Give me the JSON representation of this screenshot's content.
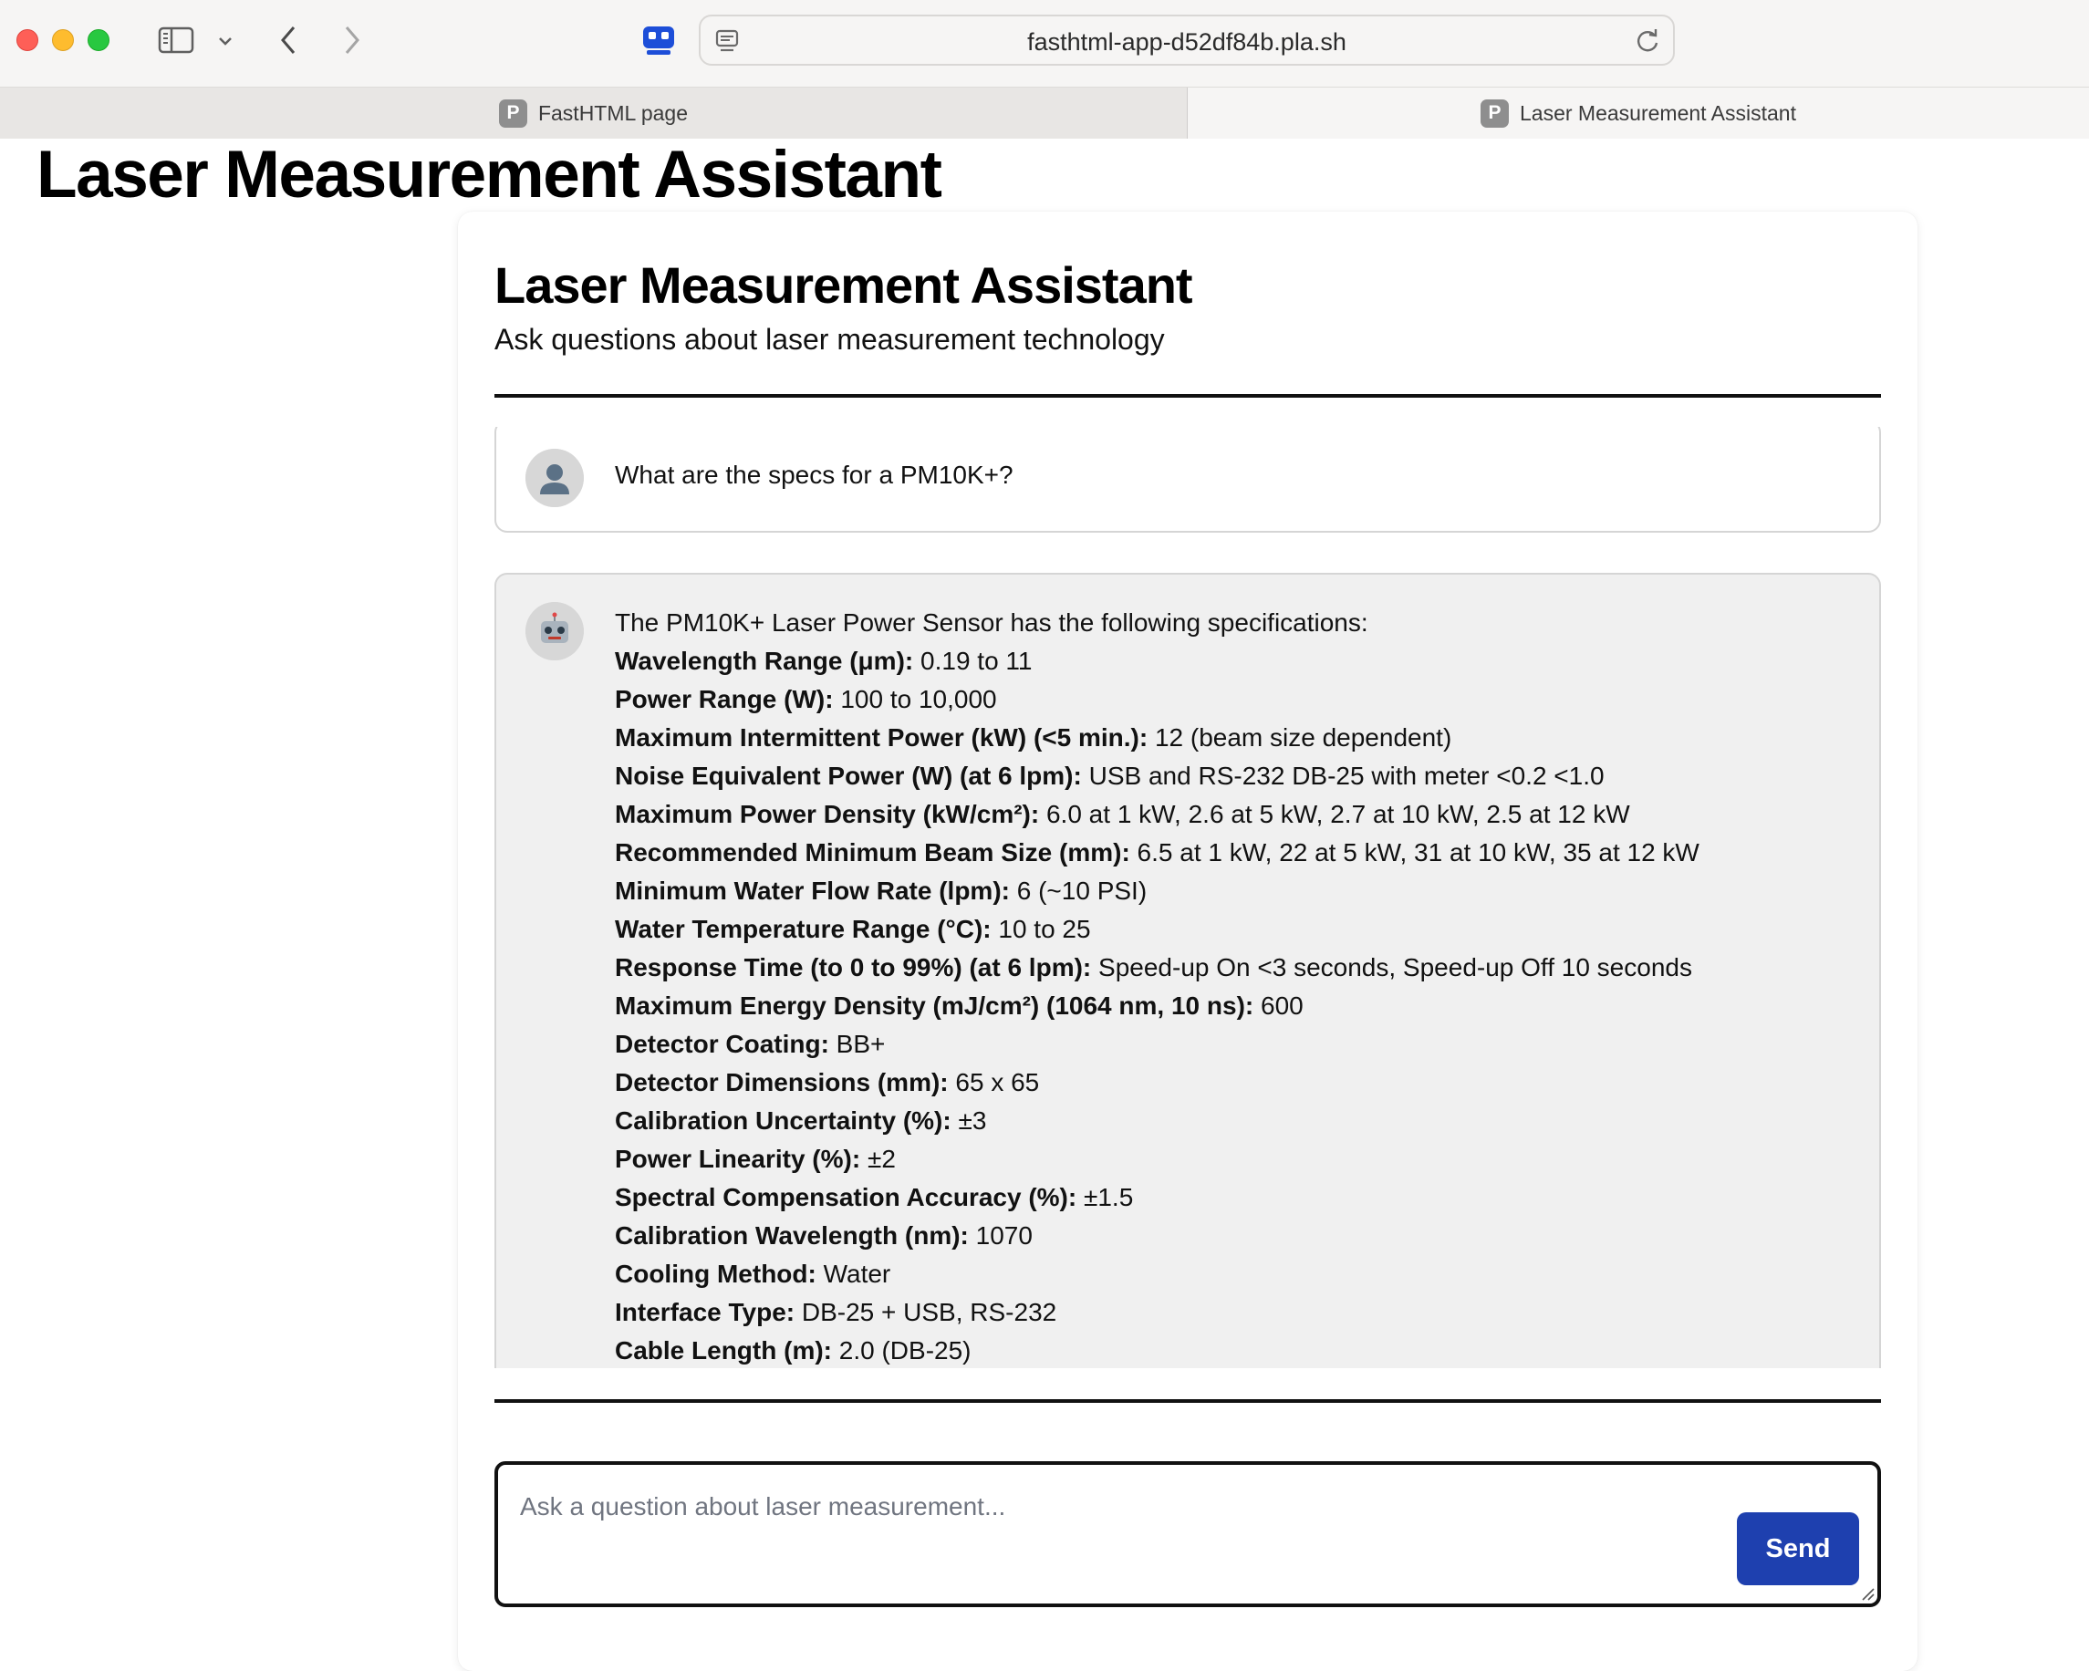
{
  "browser": {
    "url": "fasthtml-app-d52df84b.pla.sh",
    "tabs": [
      {
        "favicon_letter": "P",
        "label": "FastHTML page"
      },
      {
        "favicon_letter": "P",
        "label": "Laser Measurement Assistant"
      }
    ],
    "icons": {
      "sidebar_toggle": "sidebar-icon",
      "chevron": "chevron-down-icon",
      "back": "chevron-left-icon",
      "forward": "chevron-right-icon",
      "extension": "robot-extension-icon",
      "page": "page-icon",
      "reload": "reload-icon"
    }
  },
  "page": {
    "heading": "Laser Measurement Assistant",
    "card_title": "Laser Measurement Assistant",
    "card_subtitle": "Ask questions about laser measurement technology"
  },
  "chat": {
    "user_message": {
      "avatar": "👤",
      "text": "What are the specs for a PM10K+?"
    },
    "bot_message": {
      "avatar": "🤖",
      "intro": "The PM10K+ Laser Power Sensor has the following specifications:",
      "specs": [
        {
          "label": "Wavelength Range (μm):",
          "value": " 0.19 to 11"
        },
        {
          "label": "Power Range (W):",
          "value": " 100 to 10,000"
        },
        {
          "label": "Maximum Intermittent Power (kW) (<5 min.):",
          "value": " 12 (beam size dependent)"
        },
        {
          "label": "Noise Equivalent Power (W) (at 6 lpm):",
          "value": " USB and RS-232 DB-25 with meter <0.2 <1.0"
        },
        {
          "label": "Maximum Power Density (kW/cm²):",
          "value": " 6.0 at 1 kW, 2.6 at 5 kW, 2.7 at 10 kW, 2.5 at 12 kW"
        },
        {
          "label": "Recommended Minimum Beam Size (mm):",
          "value": " 6.5 at 1 kW, 22 at 5 kW, 31 at 10 kW, 35 at 12 kW"
        },
        {
          "label": "Minimum Water Flow Rate (lpm):",
          "value": " 6 (~10 PSI)"
        },
        {
          "label": "Water Temperature Range (°C):",
          "value": " 10 to 25"
        },
        {
          "label": "Response Time (to 0 to 99%) (at 6 lpm):",
          "value": " Speed-up On <3 seconds, Speed-up Off 10 seconds"
        },
        {
          "label": "Maximum Energy Density (mJ/cm²) (1064 nm, 10 ns):",
          "value": " 600"
        },
        {
          "label": "Detector Coating:",
          "value": " BB+"
        },
        {
          "label": "Detector Dimensions (mm):",
          "value": " 65 x 65"
        },
        {
          "label": "Calibration Uncertainty (%):",
          "value": " ±3"
        },
        {
          "label": "Power Linearity (%):",
          "value": " ±2"
        },
        {
          "label": "Spectral Compensation Accuracy (%):",
          "value": " ±1.5"
        },
        {
          "label": "Calibration Wavelength (nm):",
          "value": " 1070"
        },
        {
          "label": "Cooling Method:",
          "value": " Water"
        },
        {
          "label": "Interface Type:",
          "value": " DB-25 + USB, RS-232"
        },
        {
          "label": "Cable Length (m):",
          "value": " 2.0 (DB-25)"
        }
      ]
    }
  },
  "input": {
    "placeholder": "Ask a question about laser measurement...",
    "value": "",
    "send_label": "Send"
  },
  "colors": {
    "accent": "#1e40af",
    "bot_bubble": "#f0f0f0"
  }
}
